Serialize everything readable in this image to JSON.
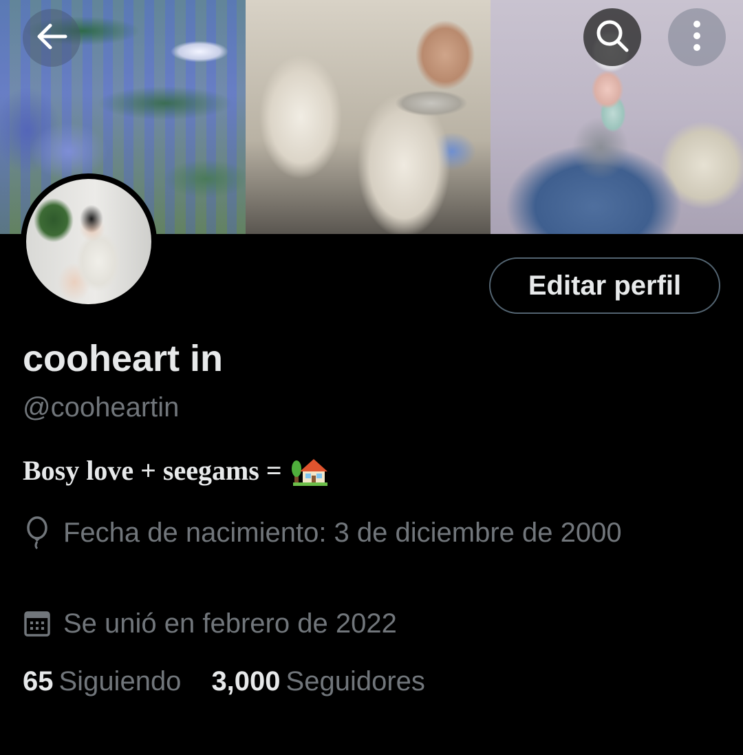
{
  "profile": {
    "display_name": "cooheart in",
    "handle": "@cooheartin",
    "bio": "Bosy love + seegams =",
    "bio_emoji": "house-with-garden-icon",
    "birth_date": "Fecha de nacimiento: 3 de diciembre de 2000",
    "joined": "Se unió en febrero de 2022",
    "following_count": "65",
    "following_label": "Siguiendo",
    "followers_count": "3,000",
    "followers_label": "Seguidores"
  },
  "actions": {
    "edit_profile": "Editar perfil"
  },
  "icons": {
    "back": "arrow-left-icon",
    "search": "search-icon",
    "more": "more-vertical-icon",
    "birthday": "balloon-icon",
    "joined": "calendar-icon"
  },
  "colors": {
    "background": "#000000",
    "primary_text": "#e7e9ea",
    "secondary_text": "#71767b",
    "button_border": "#536471"
  }
}
